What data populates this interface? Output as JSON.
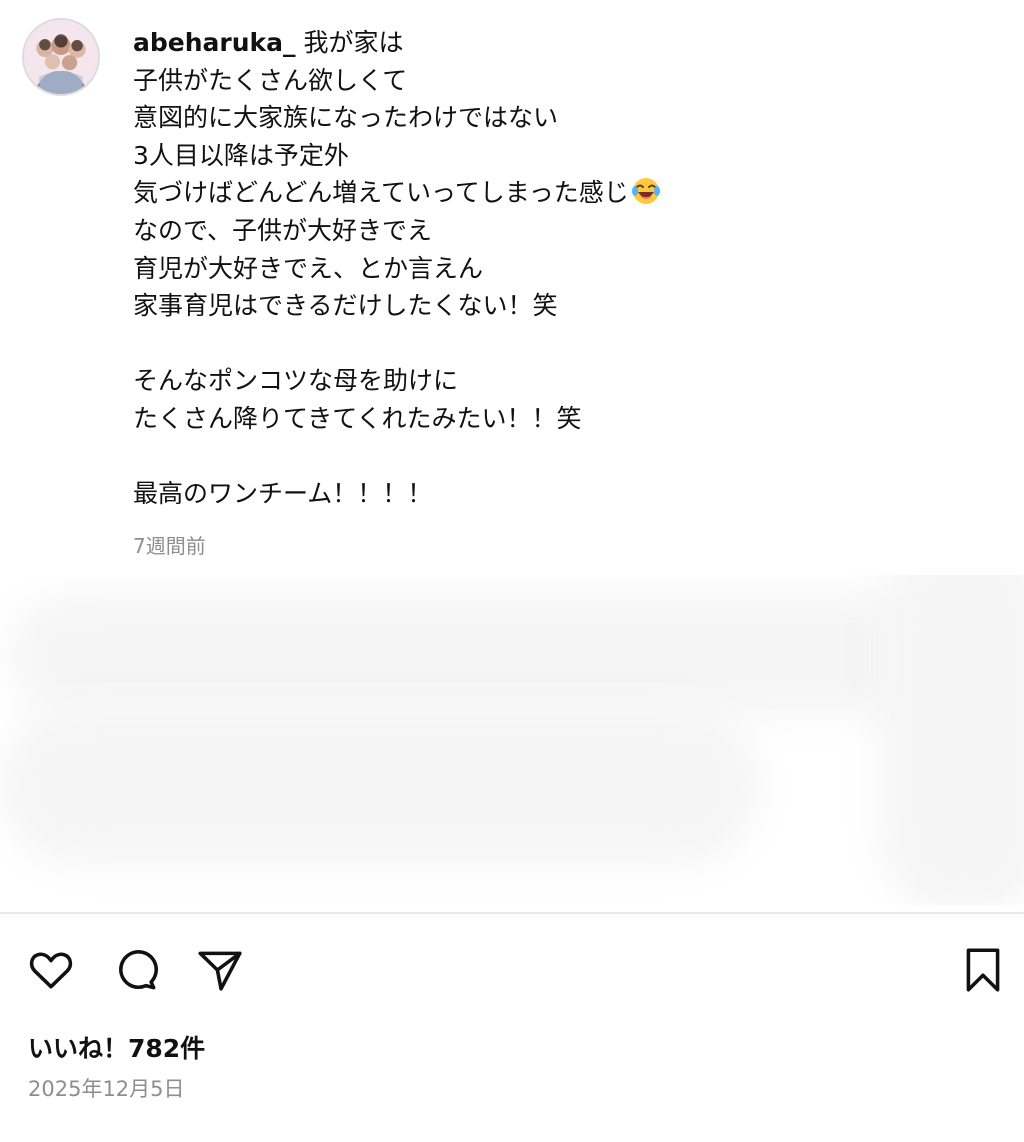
{
  "post": {
    "username": "abeharuka_",
    "caption_first_line": "我が家は",
    "caption_lines": [
      "子供がたくさん欲しくて",
      "意図的に大家族になったわけではない",
      "3人目以降は予定外",
      "気づけばどんどん増えていってしまった感じ"
    ],
    "caption_lines_after_emoji": [
      "なので、子供が大好きでえ",
      "育児が大好きでえ、とか言えん",
      "家事育児はできるだけしたくない！笑",
      "",
      "そんなポンコツな母を助けに",
      "たくさん降りてきてくれたみたい！！笑",
      "",
      "最高のワンチーム！！！！"
    ],
    "emoji_icon": "face-with-tears-of-joy-icon",
    "time_ago": "7週間前",
    "likes_label": "いいね！782件",
    "date": "2025年12月5日"
  },
  "icons": {
    "like": "heart-icon",
    "comment": "speech-bubble-icon",
    "share": "paper-plane-icon",
    "save": "bookmark-icon"
  },
  "colors": {
    "text": "#111111",
    "secondary_text": "#8e8e8e",
    "divider": "#e9e9e9",
    "emoji_yellow": "#ffc83d"
  }
}
